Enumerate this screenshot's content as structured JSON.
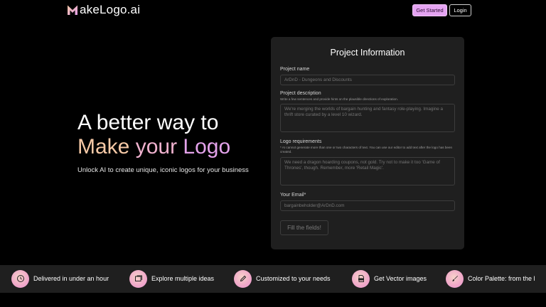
{
  "header": {
    "brand": "akeLogo.ai",
    "brand_icon": "m-logo-icon",
    "get_started_label": "Get Started",
    "login_label": "Login"
  },
  "hero": {
    "line1": "A better way to",
    "line2_part1": "Make",
    "line2_part2": "your",
    "line2_part3": "Logo",
    "subtitle": "Unlock AI to create unique, iconic logos for your business"
  },
  "form": {
    "title": "Project Information",
    "name_label": "Project name",
    "name_placeholder": "ArDnD - Dungeons and Discounts",
    "description_label": "Project description",
    "description_help": "Write a few sentences and provide hints on the plausible directions of exploration.",
    "description_placeholder": "We're merging the worlds of bargain hunting and fantasy role-playing. Imagine a thrift store curated by a level 10 wizard.",
    "requirements_label": "Logo requirements",
    "requirements_help": "* AI cannot generate more than one or two characters of text. You can use our editor to add text after the logo has been created.",
    "requirements_placeholder": "We need a dragon hoarding coupons, not gold. Try not to make it too 'Game of Thrones', though. Remember, more 'Retail Magic'.",
    "email_label": "Your Email*",
    "email_placeholder": "bargainbeholder@ArDnD.com",
    "submit_label": "Fill the fields!"
  },
  "features": [
    {
      "label": "Delivered in under an hour",
      "icon": "clock-icon"
    },
    {
      "label": "Explore multiple ideas",
      "icon": "gallery-icon"
    },
    {
      "label": "Customized to your needs",
      "icon": "pencil-icon"
    },
    {
      "label": "Get Vector images",
      "icon": "svg-file-icon"
    },
    {
      "label": "Color Palette: from the l",
      "icon": "brush-icon"
    }
  ],
  "colors": {
    "accent": "#e5a3f2",
    "panel": "#1f1f1f",
    "background": "#000000"
  }
}
